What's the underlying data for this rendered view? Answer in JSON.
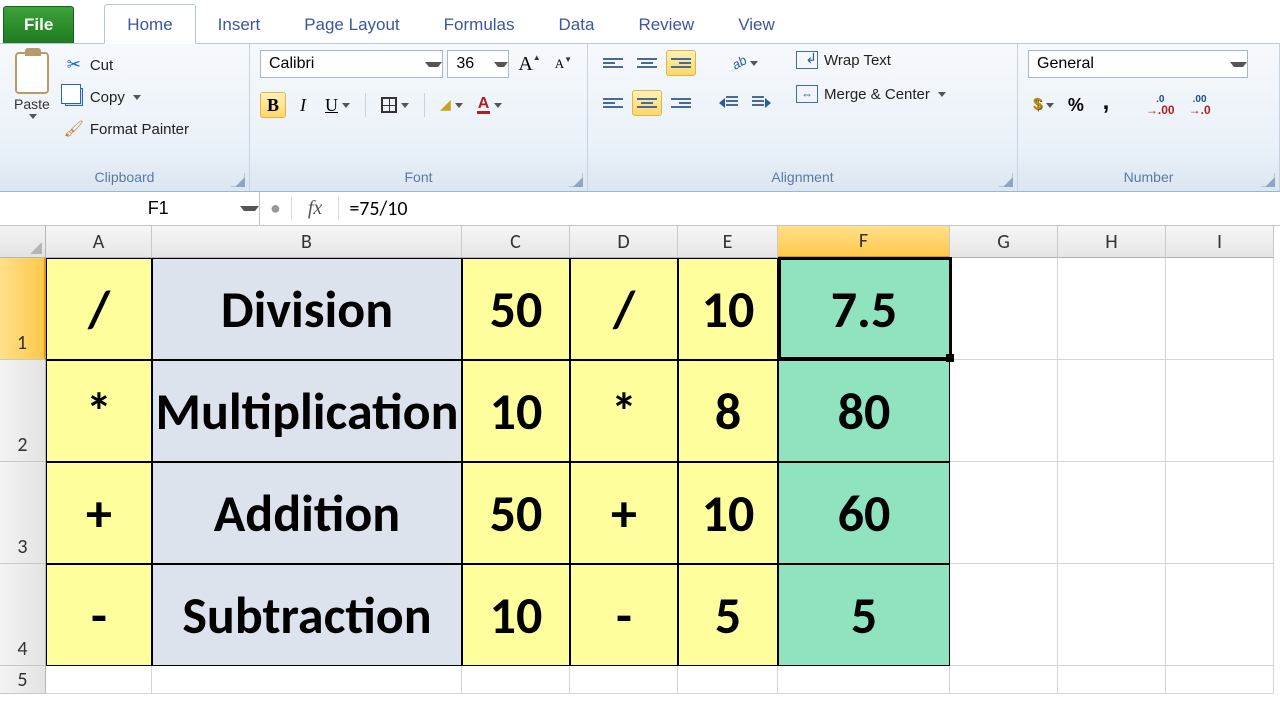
{
  "tabs": {
    "file": "File",
    "items": [
      "Home",
      "Insert",
      "Page Layout",
      "Formulas",
      "Data",
      "Review",
      "View"
    ],
    "active": "Home"
  },
  "ribbon": {
    "clipboard": {
      "title": "Clipboard",
      "paste": "Paste",
      "cut": "Cut",
      "copy": "Copy",
      "format_painter": "Format Painter"
    },
    "font": {
      "title": "Font",
      "name": "Calibri",
      "size": "36",
      "bold": "B",
      "italic": "I",
      "underline": "U"
    },
    "alignment": {
      "title": "Alignment",
      "wrap": "Wrap Text",
      "merge": "Merge & Center"
    },
    "number": {
      "title": "Number",
      "format": "General"
    }
  },
  "formula_bar": {
    "cell_ref": "F1",
    "fx": "fx",
    "formula": "=75/10"
  },
  "grid": {
    "columns": [
      "A",
      "B",
      "C",
      "D",
      "E",
      "F",
      "G",
      "H",
      "I"
    ],
    "selected_col": "F",
    "selected_row": 1,
    "rows": [
      {
        "n": "1",
        "a": "/",
        "b": "Division",
        "c": "50",
        "d": "/",
        "e": "10",
        "f": "7.5"
      },
      {
        "n": "2",
        "a": "*",
        "b": "Multiplication",
        "c": "10",
        "d": "*",
        "e": "8",
        "f": "80"
      },
      {
        "n": "3",
        "a": "+",
        "b": "Addition",
        "c": "50",
        "d": "+",
        "e": "10",
        "f": "60"
      },
      {
        "n": "4",
        "a": "-",
        "b": "Subtraction",
        "c": "10",
        "d": "-",
        "e": "5",
        "f": "5"
      }
    ],
    "empty_row": "5"
  }
}
